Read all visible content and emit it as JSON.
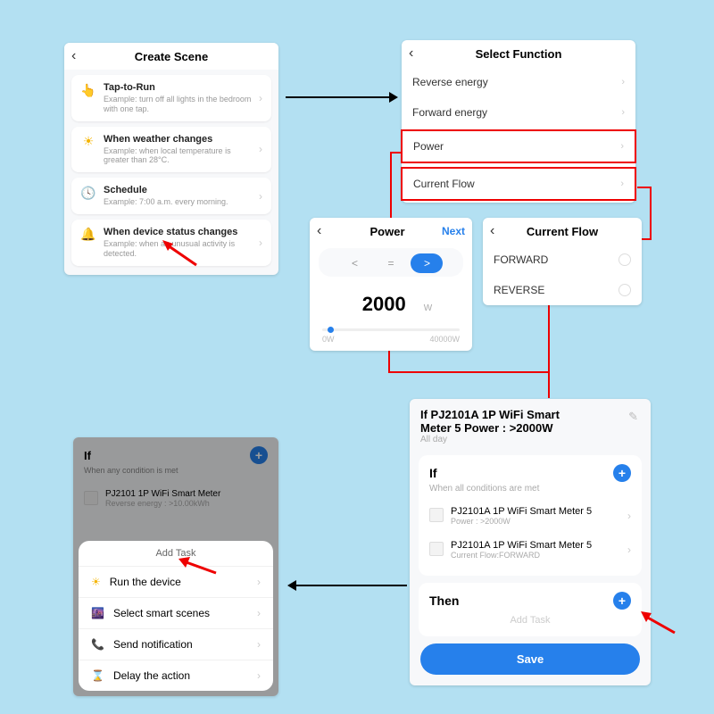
{
  "create_scene": {
    "title": "Create Scene",
    "items": [
      {
        "title": "Tap-to-Run",
        "sub": "Example: turn off all lights in the bedroom with one tap."
      },
      {
        "title": "When weather changes",
        "sub": "Example: when local temperature is greater than 28°C."
      },
      {
        "title": "Schedule",
        "sub": "Example: 7:00 a.m. every morning."
      },
      {
        "title": "When device status changes",
        "sub": "Example: when an unusual activity is detected."
      }
    ]
  },
  "select_function": {
    "title": "Select Function",
    "rows": [
      "Reverse energy",
      "Forward energy",
      "Power",
      "Current Flow"
    ]
  },
  "power_panel": {
    "title": "Power",
    "next": "Next",
    "ops": {
      "lt": "<",
      "eq": "=",
      "gt": ">"
    },
    "value": "2000",
    "unit": "W",
    "min": "0W",
    "max": "40000W"
  },
  "flow_panel": {
    "title": "Current Flow",
    "opts": [
      "FORWARD",
      "REVERSE"
    ]
  },
  "summary": {
    "title_line1": "If PJ2101A 1P WiFi Smart",
    "title_line2": "Meter  5 Power : >2000W",
    "allday": "All day",
    "if_label": "If",
    "if_sub": "When all conditions are met",
    "conds": [
      {
        "name": "PJ2101A 1P WiFi Smart Meter 5",
        "detail": "Power : >2000W"
      },
      {
        "name": "PJ2101A 1P WiFi Smart Meter 5",
        "detail": "Current Flow:FORWARD"
      }
    ],
    "then_label": "Then",
    "add_task": "Add Task",
    "save": "Save"
  },
  "addtask": {
    "if_label": "If",
    "if_sub": "When any condition is met",
    "cond_name": "PJ2101 1P WiFi Smart Meter",
    "cond_detail": "Reverse energy : >10.00kWh",
    "sheet_title": "Add Task",
    "tasks": [
      "Run the device",
      "Select smart scenes",
      "Send notification",
      "Delay the action"
    ]
  }
}
